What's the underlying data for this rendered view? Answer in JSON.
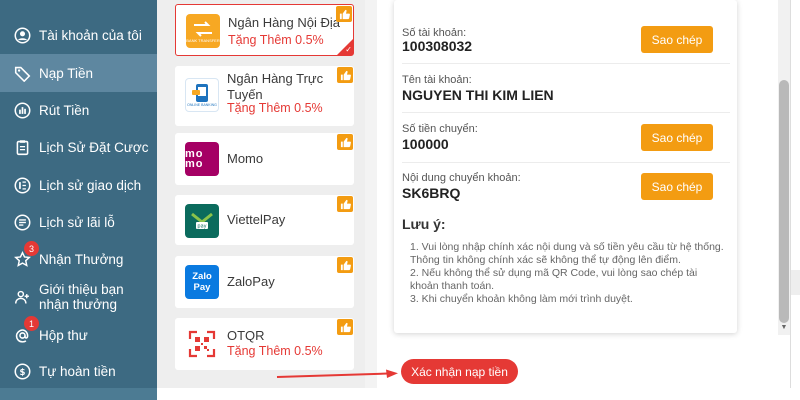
{
  "sidebar": {
    "items": [
      {
        "label": "Tài khoản của tôi",
        "icon": "user-circle-icon"
      },
      {
        "label": "Nạp Tiền",
        "icon": "tag-icon"
      },
      {
        "label": "Rút Tiền",
        "icon": "bar-chart-icon"
      },
      {
        "label": "Lịch Sử Đặt Cược",
        "icon": "clipboard-icon"
      },
      {
        "label": "Lịch sử giao dịch",
        "icon": "list-icon"
      },
      {
        "label": "Lịch sử lãi lỗ",
        "icon": "report-icon"
      },
      {
        "label": "Nhận Thưởng",
        "icon": "gift-icon",
        "badge": "3"
      },
      {
        "label": "Giới thiệu bạn nhận thưởng",
        "icon": "referral-icon"
      },
      {
        "label": "Hộp thư",
        "icon": "at-icon",
        "badge": "1"
      },
      {
        "label": "Tự hoàn tiền",
        "icon": "refund-icon"
      }
    ]
  },
  "methods": [
    {
      "name": "Ngân Hàng Nội Địa",
      "bonus": "Tặng Thêm 0.5%",
      "logo_text": "BANK TRANSFER"
    },
    {
      "name": "Ngân Hàng Trực Tuyến",
      "bonus": "Tặng Thêm 0.5%",
      "logo_text": "ONLINE BANKING"
    },
    {
      "name": "Momo",
      "logo_text": "mo mo"
    },
    {
      "name": "ViettelPay",
      "logo_text": "pay"
    },
    {
      "name": "ZaloPay",
      "logo_text": "Zalo Pay"
    },
    {
      "name": "OTQR",
      "bonus": "Tặng Thêm 0.5%"
    }
  ],
  "details": {
    "account_number_label": "Số tài khoản:",
    "account_number": "100308032",
    "account_name_label": "Tên tài khoản:",
    "account_name": "NGUYEN THI KIM LIEN",
    "amount_label": "Số tiền chuyển:",
    "amount": "100000",
    "content_label": "Nội dung chuyển khoản:",
    "content": "SK6BRQ",
    "copy_label": "Sao chép"
  },
  "notes": {
    "title": "Lưu ý:",
    "items": [
      "1. Vui lòng nhập chính xác nội dung và số tiền yêu cầu từ hệ thống. Thông tin không chính xác sẽ không thể tự động lên điểm.",
      "2. Nếu không thể sử dụng mã QR Code, vui lòng sao chép tài khoản thanh toán.",
      "3. Khi chuyển khoản không làm mới trình duyệt."
    ]
  },
  "confirm_label": "Xác nhận nạp tiền",
  "colors": {
    "sidebar": "#3d6a82",
    "accent_orange": "#f39c12",
    "accent_red": "#e53935"
  }
}
